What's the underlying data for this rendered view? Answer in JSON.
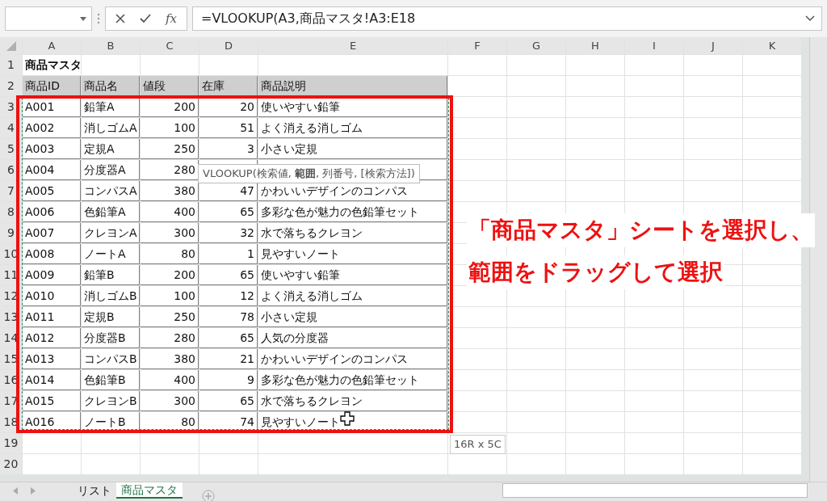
{
  "formula_bar": {
    "function_button": "fx",
    "formula": "=VLOOKUP(A3,商品マスタ!A3:E18"
  },
  "columns": [
    "A",
    "B",
    "C",
    "D",
    "E",
    "F",
    "G",
    "H",
    "I",
    "J",
    "K"
  ],
  "row_numbers": [
    "1",
    "2",
    "3",
    "4",
    "5",
    "6",
    "7",
    "8",
    "9",
    "10",
    "11",
    "12",
    "13",
    "14",
    "15",
    "16",
    "17",
    "18",
    "19",
    "20"
  ],
  "title": "商品マスタ",
  "headers": [
    "商品ID",
    "商品名",
    "値段",
    "在庫",
    "商品説明"
  ],
  "rows": [
    {
      "id": "A001",
      "name": "鉛筆A",
      "price": "200",
      "stock": "20",
      "desc": "使いやすい鉛筆"
    },
    {
      "id": "A002",
      "name": "消しゴムA",
      "price": "100",
      "stock": "51",
      "desc": "よく消える消しゴム"
    },
    {
      "id": "A003",
      "name": "定規A",
      "price": "250",
      "stock": "3",
      "desc": "小さい定規"
    },
    {
      "id": "A004",
      "name": "分度器A",
      "price": "280"
    },
    {
      "id": "A005",
      "name": "コンパスA",
      "price": "380",
      "stock": "47",
      "desc": "かわいいデザインのコンパス"
    },
    {
      "id": "A006",
      "name": "色鉛筆A",
      "price": "400",
      "stock": "65",
      "desc": "多彩な色が魅力の色鉛筆セット"
    },
    {
      "id": "A007",
      "name": "クレヨンA",
      "price": "300",
      "stock": "32",
      "desc": "水で落ちるクレヨン"
    },
    {
      "id": "A008",
      "name": "ノートA",
      "price": "80",
      "stock": "1",
      "desc": "見やすいノート"
    },
    {
      "id": "A009",
      "name": "鉛筆B",
      "price": "200",
      "stock": "65",
      "desc": "使いやすい鉛筆"
    },
    {
      "id": "A010",
      "name": "消しゴムB",
      "price": "100",
      "stock": "12",
      "desc": "よく消える消しゴム"
    },
    {
      "id": "A011",
      "name": "定規B",
      "price": "250",
      "stock": "78",
      "desc": "小さい定規"
    },
    {
      "id": "A012",
      "name": "分度器B",
      "price": "280",
      "stock": "65",
      "desc": "人気の分度器"
    },
    {
      "id": "A013",
      "name": "コンパスB",
      "price": "380",
      "stock": "21",
      "desc": "かわいいデザインのコンパス"
    },
    {
      "id": "A014",
      "name": "色鉛筆B",
      "price": "400",
      "stock": "9",
      "desc": "多彩な色が魅力の色鉛筆セット"
    },
    {
      "id": "A015",
      "name": "クレヨンB",
      "price": "300",
      "stock": "65",
      "desc": "水で落ちるクレヨン"
    },
    {
      "id": "A016",
      "name": "ノートB",
      "price": "80",
      "stock": "74",
      "desc": "見やすいノート"
    }
  ],
  "tooltip": "VLOOKUP(検索値, **範囲**, 列番号, [検索方法])",
  "selection_size": "16R x 5C",
  "annotation": [
    "「商品マスタ」シートを選択し、",
    "範囲をドラッグして選択"
  ],
  "sheet_tabs": [
    {
      "label": "リスト",
      "selected": false
    },
    {
      "label": "商品マスタ",
      "selected": true
    }
  ]
}
